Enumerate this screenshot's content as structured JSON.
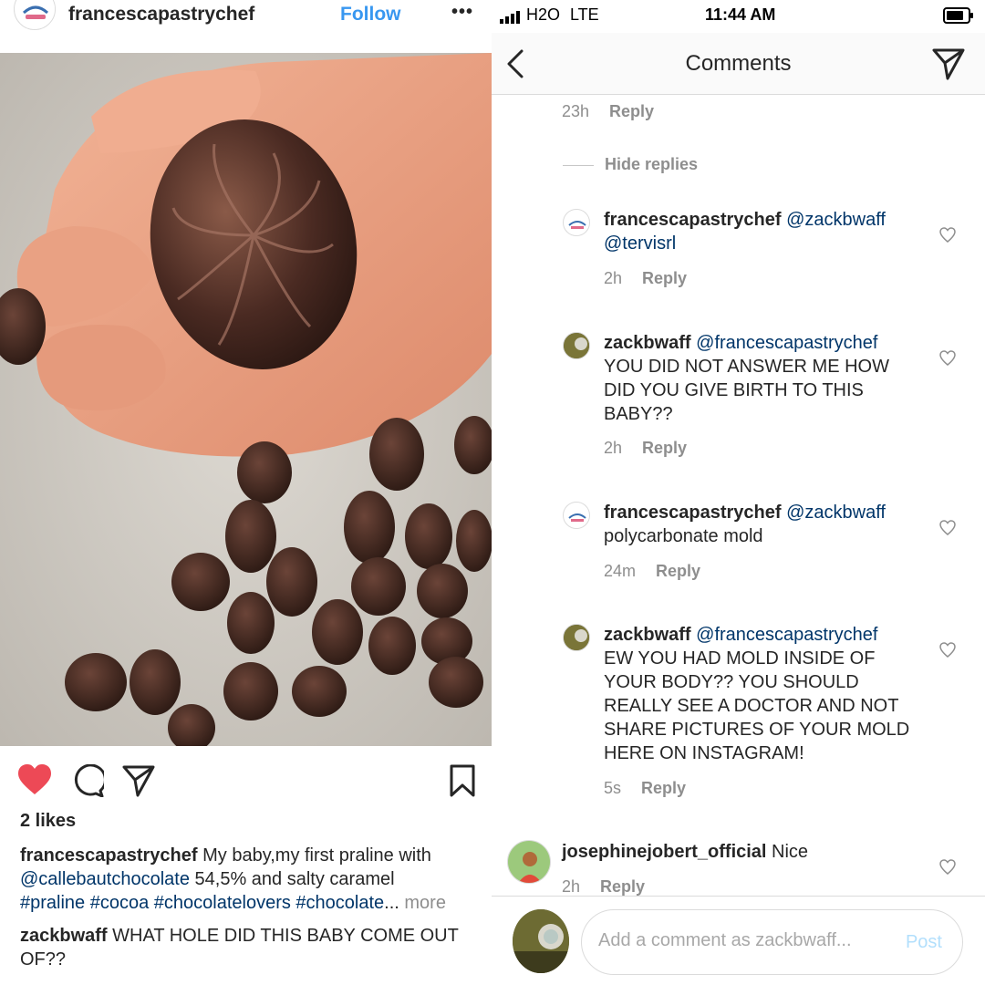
{
  "post": {
    "username": "francescapastrychef",
    "follow_label": "Follow",
    "more_label": "•••",
    "likes": "2 likes",
    "caption": {
      "username": "francescapastrychef",
      "text1": " My baby,my first praline with",
      "mention": "@callebautchocolate",
      "text2": " 54,5% and salty caramel",
      "tags": "#praline #cocoa #chocolatelovers #chocolate",
      "ellipsis": "...",
      "more": " more"
    },
    "comment": {
      "username": "zackbwaff",
      "text": " WHAT HOLE DID THIS BABY COME OUT OF??"
    }
  },
  "status": {
    "carrier": "H2O",
    "network": "LTE",
    "time": "11:44 AM"
  },
  "comments_screen": {
    "title": "Comments",
    "top_meta": {
      "time": "23h",
      "reply": "Reply"
    },
    "hide_replies": "Hide replies",
    "replies": [
      {
        "username": "francescapastrychef",
        "mention": "@zackbwaff",
        "line2": "@tervisrl",
        "time": "2h",
        "reply": "Reply"
      },
      {
        "username": "zackbwaff",
        "mention": "@francescapastrychef",
        "text": "YOU DID NOT ANSWER ME HOW DID YOU GIVE BIRTH TO THIS BABY??",
        "time": "2h",
        "reply": "Reply"
      },
      {
        "username": "francescapastrychef",
        "mention": "@zackbwaff",
        "text": "polycarbonate mold",
        "time": "24m",
        "reply": "Reply"
      },
      {
        "username": "zackbwaff",
        "mention": "@francescapastrychef",
        "text": "EW YOU HAD MOLD INSIDE OF YOUR BODY?? YOU SHOULD REALLY SEE A DOCTOR AND NOT SHARE PICTURES OF YOUR MOLD HERE ON INSTAGRAM!",
        "time": "5s",
        "reply": "Reply"
      }
    ],
    "last_comment": {
      "username": "josephinejobert_official",
      "text": " Nice",
      "time": "2h",
      "reply": "Reply"
    },
    "input": {
      "placeholder": "Add a comment as zackbwaff...",
      "post_label": "Post"
    }
  },
  "colors": {
    "link_blue": "#3897f0",
    "mention_blue": "#003569",
    "like_red": "#ed4956",
    "muted": "#8e8e8e"
  }
}
